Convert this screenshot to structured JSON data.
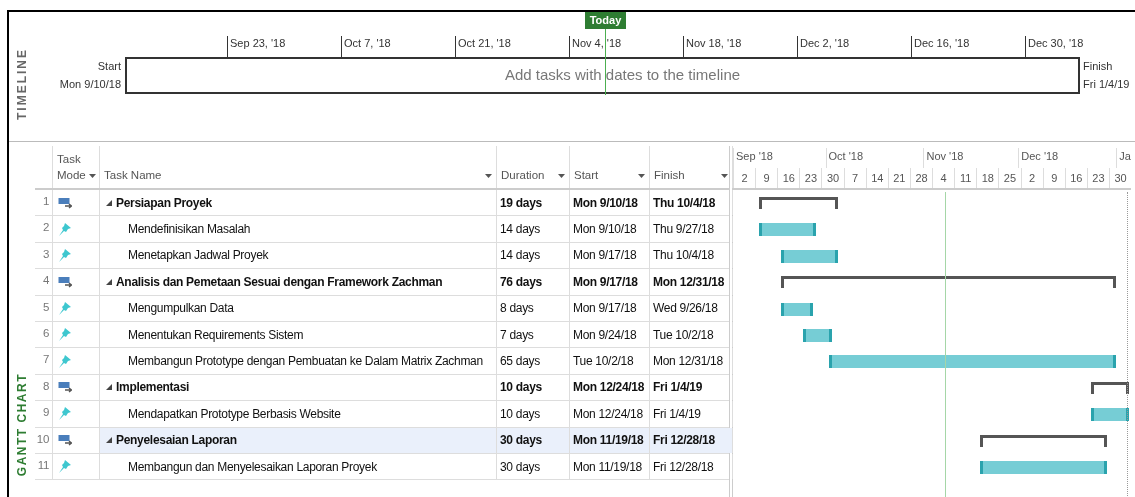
{
  "timeline": {
    "label": "TIMELINE",
    "today": "Today",
    "ticks": [
      "Sep 23, '18",
      "Oct 7, '18",
      "Oct 21, '18",
      "Nov 4, '18",
      "Nov 18, '18",
      "Dec 2, '18",
      "Dec 16, '18",
      "Dec 30, '18"
    ],
    "start_label": "Start",
    "start_date": "Mon 9/10/18",
    "finish_label": "Finish",
    "finish_date": "Fri 1/4/19",
    "placeholder": "Add tasks with dates to the timeline"
  },
  "gantt": {
    "label": "GANTT CHART",
    "columns": [
      {
        "label": "Task Mode",
        "kind": "mode"
      },
      {
        "label": "Task Name",
        "kind": "name"
      },
      {
        "label": "Duration",
        "kind": "duration"
      },
      {
        "label": "Start",
        "kind": "start"
      },
      {
        "label": "Finish",
        "kind": "finish"
      }
    ],
    "months": [
      "Sep '18",
      "Oct '18",
      "Nov '18",
      "Dec '18",
      "Ja"
    ],
    "weeks": [
      "2",
      "9",
      "16",
      "23",
      "30",
      "7",
      "14",
      "21",
      "28",
      "4",
      "11",
      "18",
      "25",
      "2",
      "9",
      "16",
      "23",
      "30"
    ],
    "tasks": [
      {
        "id": "1",
        "kind": "auto",
        "name": "Persiapan Proyek",
        "duration": "19 days",
        "start": "Mon 9/10/18",
        "finish": "Thu 10/4/18",
        "expanded": true,
        "selected": false,
        "children": [
          {
            "id": "2",
            "kind": "manual",
            "name": "Mendefinisikan Masalah",
            "duration": "14 days",
            "start": "Mon 9/10/18",
            "finish": "Thu 9/27/18",
            "selected": false
          },
          {
            "id": "3",
            "kind": "manual",
            "name": "Menetapkan Jadwal Proyek",
            "duration": "14 days",
            "start": "Mon 9/17/18",
            "finish": "Thu 10/4/18",
            "selected": false
          }
        ]
      },
      {
        "id": "4",
        "kind": "auto",
        "name": "Analisis dan Pemetaan Sesuai dengan Framework Zachman",
        "duration": "76 days",
        "start": "Mon 9/17/18",
        "finish": "Mon 12/31/18",
        "expanded": true,
        "selected": false,
        "children": [
          {
            "id": "5",
            "kind": "manual",
            "name": "Mengumpulkan Data",
            "duration": "8 days",
            "start": "Mon 9/17/18",
            "finish": "Wed 9/26/18",
            "selected": false
          },
          {
            "id": "6",
            "kind": "manual",
            "name": "Menentukan Requirements Sistem",
            "duration": "7 days",
            "start": "Mon 9/24/18",
            "finish": "Tue 10/2/18",
            "selected": false
          },
          {
            "id": "7",
            "kind": "manual",
            "name": "Membangun Prototype dengan Pembuatan ke Dalam Matrix Zachman",
            "duration": "65 days",
            "start": "Tue 10/2/18",
            "finish": "Mon 12/31/18",
            "selected": false
          }
        ]
      },
      {
        "id": "8",
        "kind": "auto",
        "name": "Implementasi",
        "duration": "10 days",
        "start": "Mon 12/24/18",
        "finish": "Fri 1/4/19",
        "expanded": true,
        "selected": false,
        "children": [
          {
            "id": "9",
            "kind": "manual",
            "name": "Mendapatkan Prototype Berbasis Website",
            "duration": "10 days",
            "start": "Mon 12/24/18",
            "finish": "Fri 1/4/19",
            "selected": false
          }
        ]
      },
      {
        "id": "10",
        "kind": "auto",
        "name": "Penyelesaian Laporan",
        "duration": "30 days",
        "start": "Mon 11/19/18",
        "finish": "Fri 12/28/18",
        "expanded": true,
        "selected": true,
        "children": [
          {
            "id": "11",
            "kind": "manual",
            "name": "Membangun dan Menyelesaikan Laporan Proyek",
            "duration": "30 days",
            "start": "Mon 11/19/18",
            "finish": "Fri 12/28/18",
            "selected": false
          }
        ]
      }
    ]
  }
}
